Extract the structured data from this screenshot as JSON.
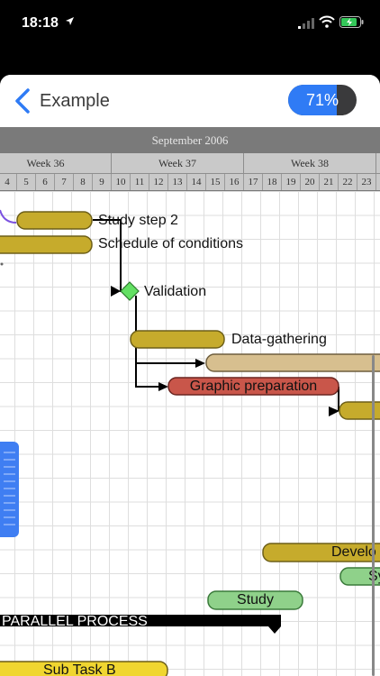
{
  "status": {
    "time": "18:18"
  },
  "nav": {
    "back_label": "Example",
    "progress_text": "71%",
    "progress": 0.71
  },
  "timeline": {
    "month": "September 2006",
    "weeks": [
      "Week 36",
      "Week 37",
      "Week 38"
    ],
    "days": [
      "4",
      "5",
      "6",
      "7",
      "8",
      "9",
      "10",
      "11",
      "12",
      "13",
      "14",
      "15",
      "16",
      "17",
      "18",
      "19",
      "20",
      "21",
      "22",
      "23"
    ]
  },
  "tasks": {
    "study_step_2": "Study step 2",
    "schedule_of_conditions": "Schedule of conditions",
    "validation": "Validation",
    "data_gathering": "Data-gathering",
    "graphic_preparation": "Graphic preparation",
    "develo": "Develo",
    "sy": "Sy",
    "study": "Study",
    "parallel_process": "PARALLEL PROCESS",
    "sub_task_b": "Sub Task B"
  },
  "colors": {
    "olive": "#c6ab2c",
    "tan": "#d7bf8f",
    "red": "#c9564a",
    "green": "#8fd18a",
    "yellow": "#f0d630",
    "milestone": "#63e063",
    "accent": "#2f7bf5"
  }
}
